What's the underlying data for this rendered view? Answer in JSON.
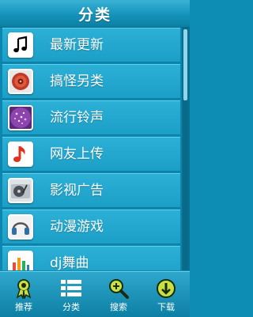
{
  "header": {
    "title": "分类"
  },
  "categories": [
    {
      "label": "最新更新",
      "icon": "music-note-icon"
    },
    {
      "label": "搞怪另类",
      "icon": "speaker-icon"
    },
    {
      "label": "流行铃声",
      "icon": "sparkle-ball-icon"
    },
    {
      "label": "网友上传",
      "icon": "red-music-note-icon"
    },
    {
      "label": "影视广告",
      "icon": "turntable-icon"
    },
    {
      "label": "动漫游戏",
      "icon": "headphones-icon"
    },
    {
      "label": "dj舞曲",
      "icon": "equalizer-icon"
    }
  ],
  "tabs": [
    {
      "label": "推荐",
      "icon": "award-ribbon-icon"
    },
    {
      "label": "分类",
      "icon": "list-icon"
    },
    {
      "label": "搜索",
      "icon": "magnifier-icon"
    },
    {
      "label": "下载",
      "icon": "download-icon"
    }
  ],
  "colors": {
    "accent": "#1c9fc7",
    "icon_green": "#c8e040"
  }
}
